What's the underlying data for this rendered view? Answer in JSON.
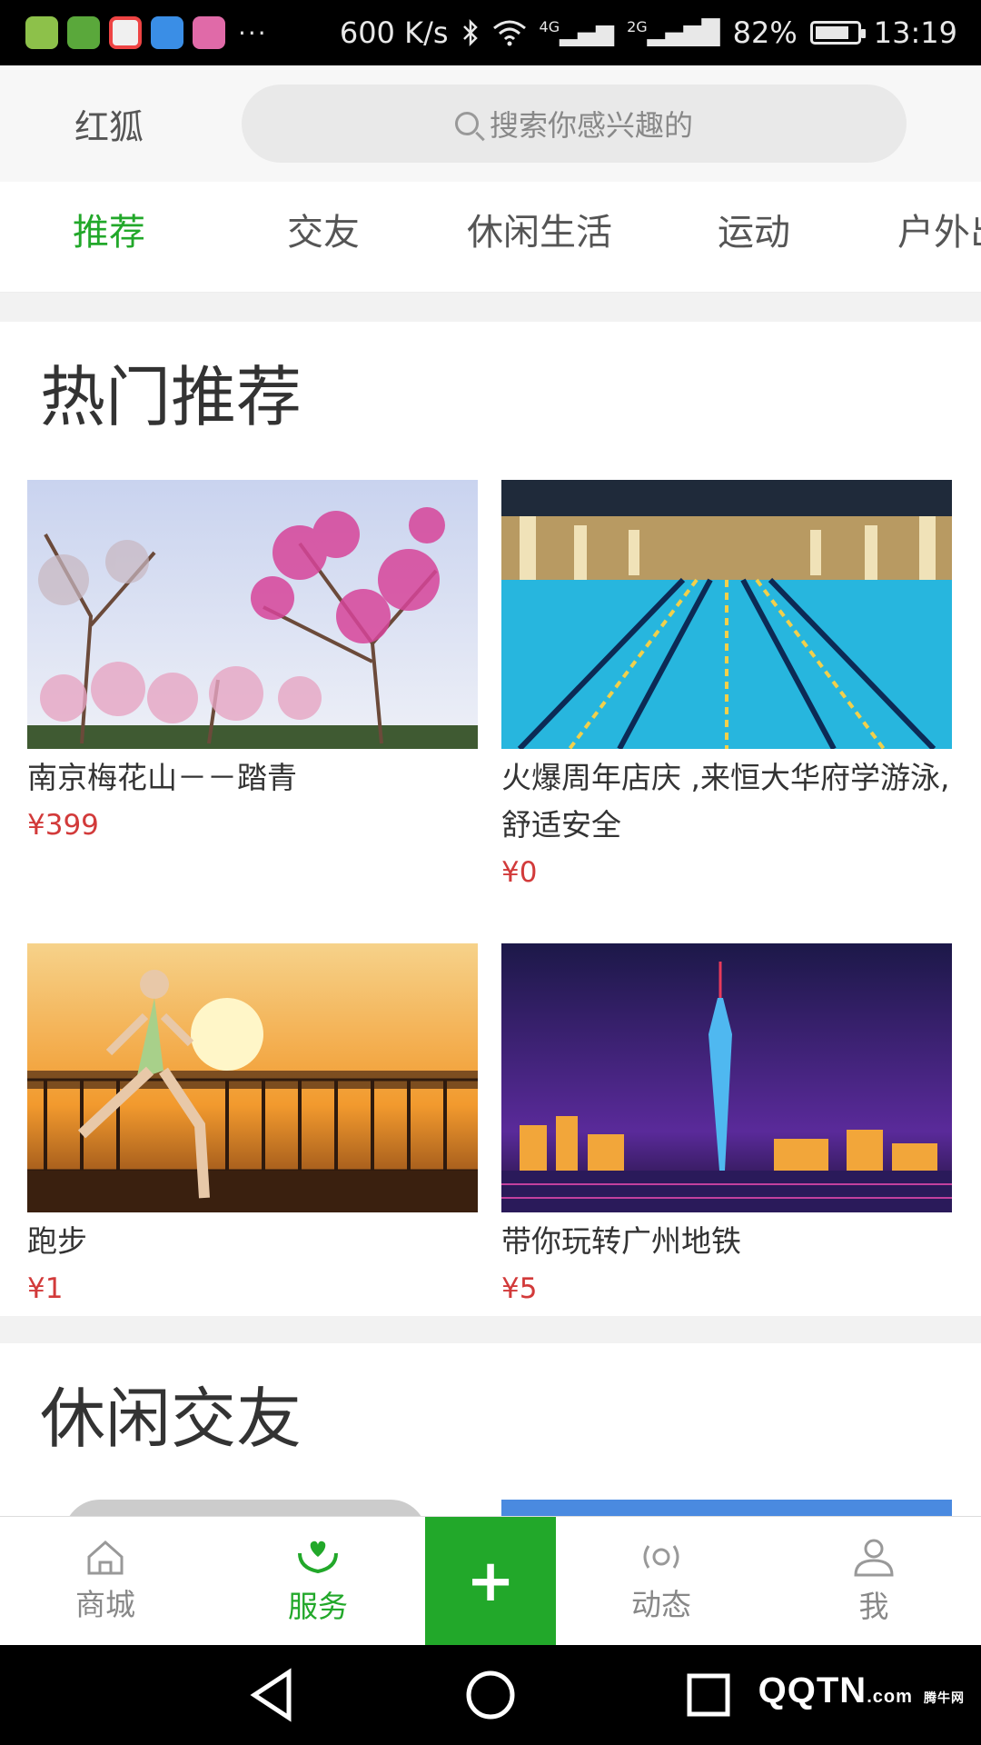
{
  "status_bar": {
    "speed": "600 K/s",
    "net1": "4G",
    "net2": "2G",
    "battery_text": "82%",
    "battery_level": 0.82,
    "time": "13:19",
    "more": "···"
  },
  "header": {
    "brand": "红狐",
    "search_placeholder": "搜索你感兴趣的"
  },
  "tabs": [
    {
      "label": "推荐",
      "active": true
    },
    {
      "label": "交友",
      "active": false
    },
    {
      "label": "休闲生活",
      "active": false
    },
    {
      "label": "运动",
      "active": false
    },
    {
      "label": "户外出",
      "active": false
    }
  ],
  "sections": [
    {
      "title": "热门推荐",
      "cards": [
        {
          "title": "南京梅花山－－踏青",
          "price": "¥399",
          "image": "plum-blossom-trees"
        },
        {
          "title": "火爆周年店庆 ,来恒大华府学游泳,舒适安全",
          "price": "¥0",
          "image": "indoor-swimming-pool"
        },
        {
          "title": "跑步",
          "price": "¥1",
          "image": "runner-at-sunset"
        },
        {
          "title": "带你玩转广州地铁",
          "price": "¥5",
          "image": "canton-tower-night"
        }
      ]
    },
    {
      "title": "休闲交友"
    }
  ],
  "bottom_nav": [
    {
      "label": "商城",
      "icon": "home-icon",
      "active": false
    },
    {
      "label": "服务",
      "icon": "heart-hands-icon",
      "active": true
    },
    {
      "label": "+",
      "icon": "plus-icon",
      "active": false
    },
    {
      "label": "动态",
      "icon": "broadcast-icon",
      "active": false
    },
    {
      "label": "我",
      "icon": "person-icon",
      "active": false
    }
  ],
  "watermark": {
    "text": "QQTN",
    "suffix": ".com",
    "tag": "腾牛网"
  },
  "colors": {
    "accent": "#22a82a",
    "price": "#d23a3a"
  }
}
